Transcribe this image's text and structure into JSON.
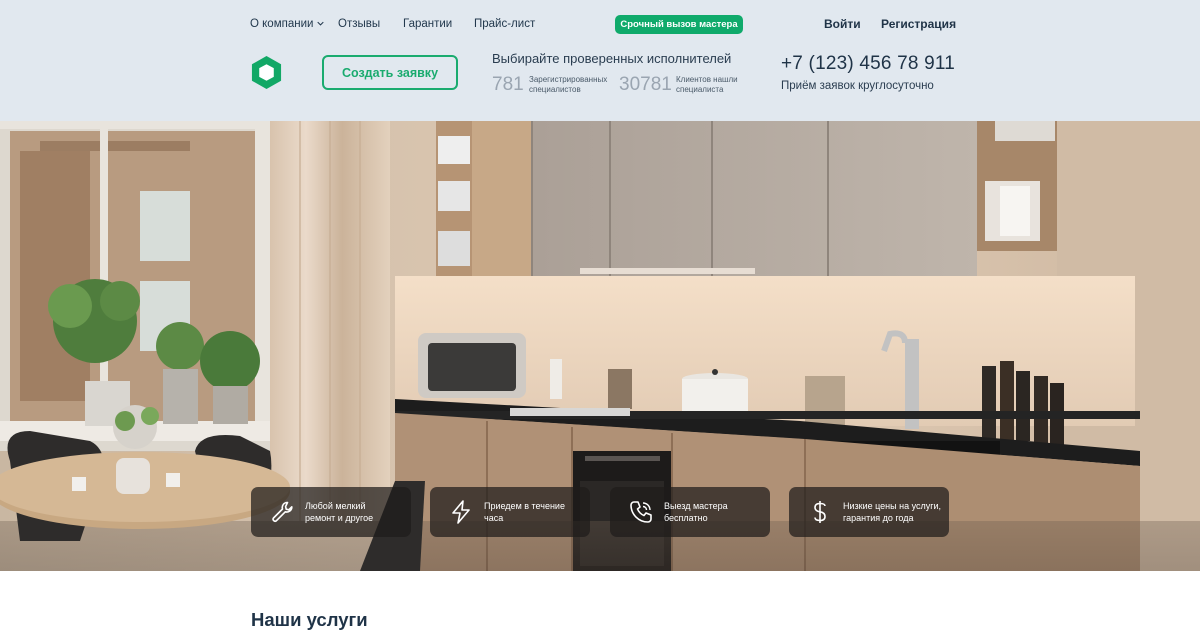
{
  "nav": {
    "about": "О компании",
    "reviews": "Отзывы",
    "guarantees": "Гарантии",
    "pricelist": "Прайс-лист",
    "urgent": "Срочный вызов мастера",
    "login": "Войти",
    "register": "Регистрация"
  },
  "header": {
    "create_request": "Создать заявку",
    "promo_title": "Выбирайте проверенных исполнителей",
    "stats": [
      {
        "value": "781",
        "caption_line1": "Зарегистрированных",
        "caption_line2": "специалистов"
      },
      {
        "value": "30781",
        "caption_line1": "Клиентов нашли",
        "caption_line2": "специалиста"
      }
    ],
    "phone": "+7 (123) 456 78 911",
    "phone_caption": "Приём заявок круглосуточно"
  },
  "features": [
    {
      "icon": "wrench-icon",
      "line1": "Любой мелкий",
      "line2": "ремонт и другое"
    },
    {
      "icon": "lightning-icon",
      "line1": "Приедем в течение",
      "line2": "часа"
    },
    {
      "icon": "phone-icon",
      "line1": "Выезд мастера",
      "line2": "бесплатно"
    },
    {
      "icon": "dollar-icon",
      "line1": "Низкие цены на услуги,",
      "line2": "гарантия до года"
    }
  ],
  "services": {
    "title": "Наши услуги"
  },
  "colors": {
    "accent": "#0faa6b",
    "header_bg": "#e1e8ef",
    "text_dark": "#1f3347"
  }
}
